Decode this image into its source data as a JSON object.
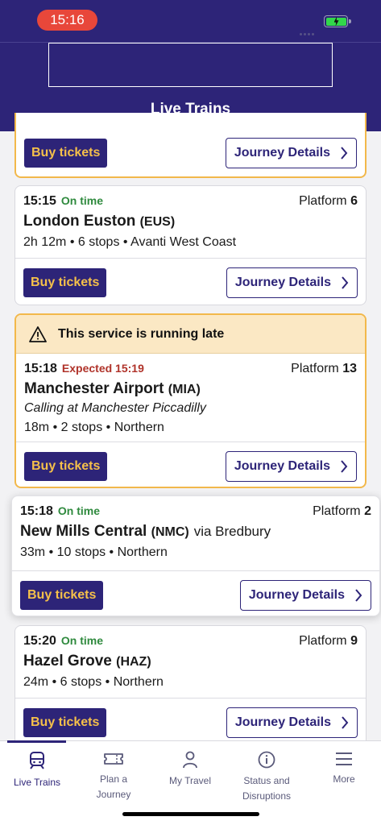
{
  "status_bar": {
    "time": "15:16"
  },
  "header": {
    "title": "Live Trains"
  },
  "buttons": {
    "buy": "Buy tickets",
    "details": "Journey Details"
  },
  "late_banner": "This service is running late",
  "services": [
    {
      "time": "15:15",
      "status": "On time",
      "platform_label": "Platform",
      "platform": "6",
      "destination": "London Euston",
      "code": "(EUS)",
      "meta": "2h 12m • 6 stops • Avanti West Coast"
    },
    {
      "time": "15:18",
      "status": "Expected 15:19",
      "platform_label": "Platform",
      "platform": "13",
      "destination": "Manchester Airport",
      "code": "(MIA)",
      "calling": "Calling at Manchester Piccadilly",
      "meta": "18m • 2 stops • Northern"
    },
    {
      "time": "15:18",
      "status": "On time",
      "platform_label": "Platform",
      "platform": "2",
      "destination": "New Mills Central",
      "code": "(NMC)",
      "via": "via Bredbury",
      "meta": "33m • 10 stops • Northern"
    },
    {
      "time": "15:20",
      "status": "On time",
      "platform_label": "Platform",
      "platform": "9",
      "destination": "Hazel Grove",
      "code": "(HAZ)",
      "meta": "24m • 6 stops • Northern"
    }
  ],
  "tabs": [
    {
      "label": "Live Trains",
      "icon": "train-icon"
    },
    {
      "label": "Plan a Journey",
      "icon": "ticket-icon"
    },
    {
      "label": "My Travel",
      "icon": "person-icon"
    },
    {
      "label": "Status and Disruptions",
      "icon": "info-icon"
    },
    {
      "label": "More",
      "icon": "menu-icon"
    }
  ]
}
